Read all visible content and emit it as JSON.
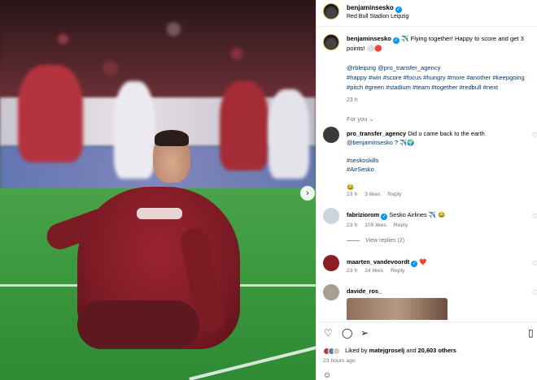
{
  "post": {
    "username": "benjaminsesko",
    "location": "Red Bull Stadion Leipzig",
    "caption_user": "benjaminsesko",
    "caption_line1": "✈️ Flying together! Happy to score and get 3 points! ⚪🔴",
    "mentions": "@rbleipzig @pro_transfer_agency",
    "hashtags": "#happy #win #score #focus #hungry #more #another #keepgoing #pitch #green #stadium #team #together #redbull #next",
    "caption_time": "23 h",
    "for_you_label": "For you ⌄"
  },
  "comments": [
    {
      "username": "pro_transfer_agency",
      "text": "Did u came back to the earth",
      "mention": "@benjaminsesko",
      "text_tail": "? ✈️🌍",
      "tags": "#seskoskills",
      "tags2": "#AirSesko",
      "emoji_line": "😂",
      "time": "23 h",
      "likes": "3 likes",
      "reply": "Reply",
      "avatar_color": "#3a3a3a"
    },
    {
      "username": "fabriziorom",
      "text": "Sesko Airlines ✈️ 😂",
      "time": "23 h",
      "likes": "109 likes",
      "reply": "Reply",
      "view_replies": "View replies (2)",
      "avatar_color": "#c9d6e0"
    },
    {
      "username": "maarten_vandevoordt",
      "text": "❤️",
      "time": "23 h",
      "likes": "24 likes",
      "reply": "Reply",
      "avatar_color": "#8a1e24"
    },
    {
      "username": "davide_ros_",
      "avatar_color": "#a79e8f"
    }
  ],
  "actions": {
    "like_icon": "heart-icon",
    "comment_icon": "comment-icon",
    "share_icon": "share-icon",
    "save_icon": "bookmark-icon",
    "liked_prefix": "Liked by",
    "liked_user": "matejgroselj",
    "liked_and": "and",
    "liked_count": "20,603 others",
    "posted": "23 hours ago"
  },
  "colors": {
    "link": "#00376b",
    "verified": "#0095f6",
    "muted": "#737373"
  }
}
